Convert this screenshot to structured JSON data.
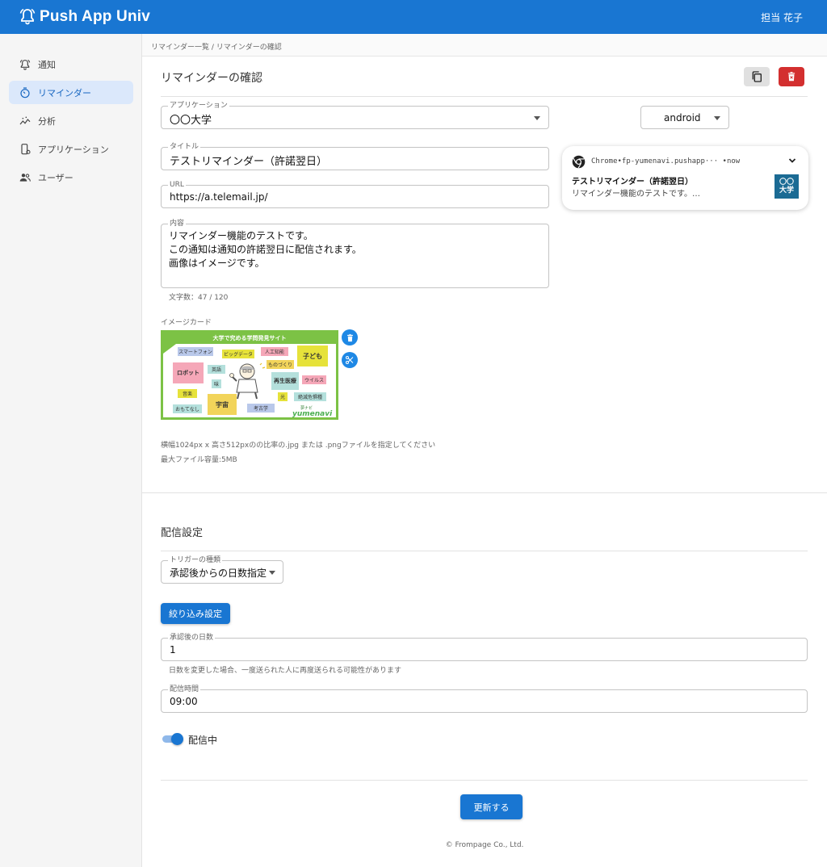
{
  "header": {
    "app_title": "Push App Univ",
    "user_name": "担当 花子",
    "color": "#1976d2"
  },
  "sidebar": {
    "items": [
      {
        "label": "通知",
        "icon": "bell-icon"
      },
      {
        "label": "リマインダー",
        "icon": "timer-icon",
        "active": true
      },
      {
        "label": "分析",
        "icon": "analytics-icon"
      },
      {
        "label": "アプリケーション",
        "icon": "phone-settings-icon"
      },
      {
        "label": "ユーザー",
        "icon": "people-icon"
      }
    ]
  },
  "breadcrumb": {
    "text": "リマインダー一覧 / リマインダーの確認"
  },
  "page": {
    "title": "リマインダーの確認"
  },
  "form": {
    "application": {
      "label": "アプリケーション",
      "value": "〇〇大学"
    },
    "title": {
      "label": "タイトル",
      "value": "テストリマインダー（許諾翌日）"
    },
    "url": {
      "label": "URL",
      "value": "https://a.telemail.jp/"
    },
    "content": {
      "label": "内容",
      "lines": [
        "リマインダー機能のテストです。",
        "この通知は通知の許諾翌日に配信されます。",
        "画像はイメージです。"
      ],
      "char_count": "文字数：47 / 120"
    },
    "image": {
      "label": "イメージカード",
      "hint1": "横幅1024px x 高さ512pxのの比率の.jpg または .pngファイルを指定してください",
      "hint2": "最大ファイル容量:5MB"
    }
  },
  "banner": {
    "header": "大学で究める学問発見サイト",
    "tags": [
      "スマートフォン",
      "ビッグデータ",
      "人工知能",
      "子ども",
      "ものづくり",
      "ロボット",
      "英語",
      "味",
      "再生医療",
      "ウイルス",
      "音楽",
      "宇宙",
      "光",
      "絶滅危惧種",
      "おもてなし",
      "考古学"
    ],
    "logo_small": "夢ナビ",
    "logo": "yumenavi"
  },
  "preview": {
    "platform": "android",
    "source": "Chrome•fp-yumenavi.pushapp···  •now",
    "title": "テストリマインダー（許諾翌日）",
    "body": "リマインダー機能のテストです。…",
    "icon_text_1": "〇〇",
    "icon_text_2": "大学"
  },
  "delivery": {
    "section_title": "配信設定",
    "trigger": {
      "label": "トリガーの種類",
      "value": "承認後からの日数指定"
    },
    "filter_button": "絞り込み設定",
    "days": {
      "label": "承認後の日数",
      "value": "1",
      "helper": "日数を変更した場合、一度送られた人に再度送られる可能性があります"
    },
    "time": {
      "label": "配信時間",
      "value": "09:00"
    },
    "toggle_label": "配信中",
    "toggle_on": true
  },
  "submit_label": "更新する",
  "footer": "© Frompage Co., Ltd."
}
